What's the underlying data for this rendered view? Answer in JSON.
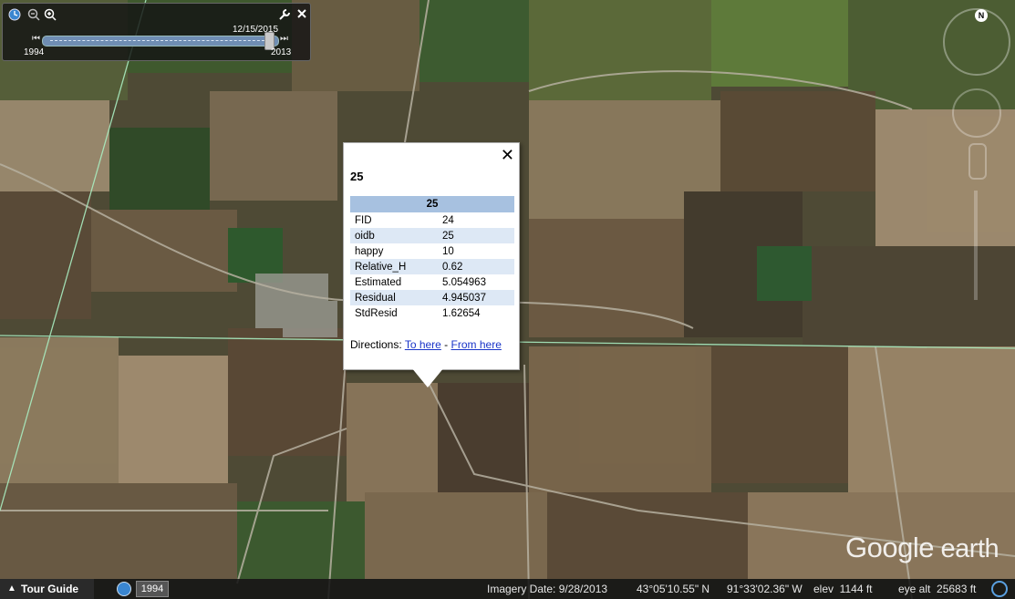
{
  "timebar": {
    "start_year": "1994",
    "end_year": "2013",
    "current_date": "12/15/2015",
    "icons": [
      "clock-icon",
      "zoom-out-icon",
      "zoom-in-icon",
      "wrench-icon",
      "close-icon"
    ]
  },
  "popup": {
    "title": "25",
    "table_header": "25",
    "rows": [
      {
        "field": "FID",
        "value": "24"
      },
      {
        "field": "oidb",
        "value": "25"
      },
      {
        "field": "happy",
        "value": "10"
      },
      {
        "field": "Relative_H",
        "value": "0.62"
      },
      {
        "field": "Estimated",
        "value": "5.054963"
      },
      {
        "field": "Residual",
        "value": "4.945037"
      },
      {
        "field": "StdResid",
        "value": "1.62654"
      }
    ],
    "directions_label": "Directions:",
    "to_here": "To here",
    "separator": " - ",
    "from_here": "From here",
    "close_symbol": "✕"
  },
  "nav": {
    "compass_north": "N"
  },
  "watermark": {
    "google": "Google",
    "earth": " earth"
  },
  "statusbar": {
    "tour_guide": "Tour Guide",
    "tour_arrow": "▲",
    "historical_year": "1994",
    "imagery_date": "Imagery Date: 9/28/2013",
    "lat": "43°05'10.55\" N",
    "lon": "91°33'02.36\" W",
    "elev": "elev  1144 ft",
    "eye_alt": "eye alt  25683 ft"
  }
}
